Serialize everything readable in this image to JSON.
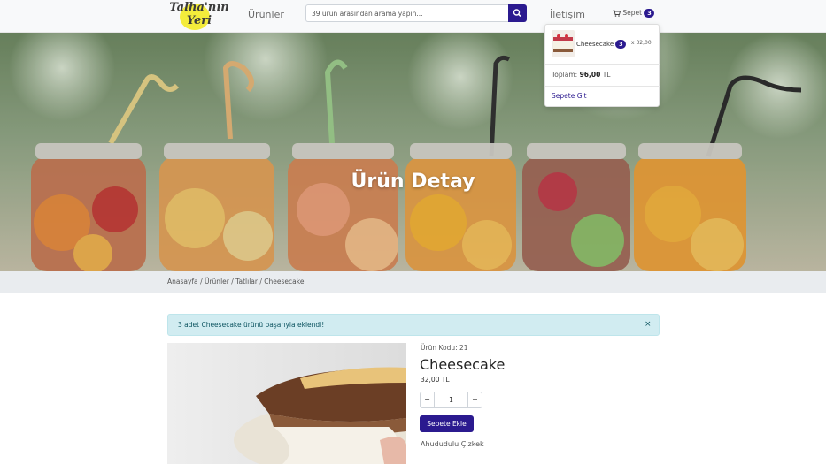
{
  "brand": {
    "line1": "Talha'nın",
    "line2": "Yeri"
  },
  "nav": {
    "products": "Ürünler",
    "contact": "İletişim",
    "cart": "Sepet",
    "cart_count": "3"
  },
  "search": {
    "placeholder": "39 ürün arasından arama yapın..."
  },
  "hero": {
    "title": "Ürün Detay"
  },
  "breadcrumb": [
    "Anasayfa",
    "Ürünler",
    "Tatlılar",
    "Cheesecake"
  ],
  "alert": {
    "message": "3 adet Cheesecake ürünü başarıyla eklendi!",
    "close": "×"
  },
  "product": {
    "code": "Ürün Kodu: 21",
    "name": "Cheesecake",
    "price": "32,00 TL",
    "quantity": "1",
    "minus": "−",
    "plus": "+",
    "add_button": "Sepete Ekle",
    "description": "Ahududulu Çizkek"
  },
  "cart_dropdown": {
    "item_name": "Cheesecake",
    "item_qty": "3",
    "item_price": "x 32,00",
    "total_label": "Toplam:",
    "total_value": "96,00",
    "total_currency": "TL",
    "go_to_cart": "Sepete Git"
  },
  "colors": {
    "primary": "#2b1a8f",
    "alert_bg": "#d1ecf1",
    "navbar_bg": "#f8f9fa"
  }
}
